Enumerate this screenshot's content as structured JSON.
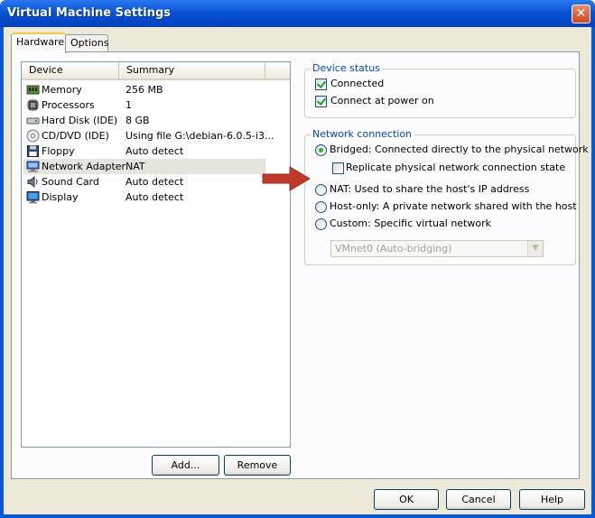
{
  "window": {
    "title": "Virtual Machine Settings",
    "close": "✕"
  },
  "tabs": [
    {
      "label": "Hardware"
    },
    {
      "label": "Options"
    }
  ],
  "device_list": {
    "columns": [
      "Device",
      "Summary"
    ],
    "rows": [
      {
        "device": "Memory",
        "summary": "256 MB",
        "icon": "memory-icon"
      },
      {
        "device": "Processors",
        "summary": "1",
        "icon": "processor-icon"
      },
      {
        "device": "Hard Disk (IDE)",
        "summary": "8 GB",
        "icon": "hard-disk-icon"
      },
      {
        "device": "CD/DVD (IDE)",
        "summary": "Using file G:\\debian-6.0.5-i3...",
        "icon": "cd-dvd-icon"
      },
      {
        "device": "Floppy",
        "summary": "Auto detect",
        "icon": "floppy-icon"
      },
      {
        "device": "Network Adapter",
        "summary": "NAT",
        "icon": "network-adapter-icon"
      },
      {
        "device": "Sound Card",
        "summary": "Auto detect",
        "icon": "sound-card-icon"
      },
      {
        "device": "Display",
        "summary": "Auto detect",
        "icon": "display-icon"
      }
    ]
  },
  "list_buttons": {
    "add": "Add...",
    "remove": "Remove"
  },
  "device_status": {
    "title": "Device status",
    "connected": "Connected",
    "connect_at_power_on": "Connect at power on"
  },
  "network_connection": {
    "title": "Network connection",
    "bridged": "Bridged: Connected directly to the physical network",
    "replicate": "Replicate physical network connection state",
    "nat": "NAT: Used to share the host's IP address",
    "host_only": "Host-only: A private network shared with the host",
    "custom": "Custom: Specific virtual network",
    "custom_select": "VMnet0 (Auto-bridging)"
  },
  "footer": {
    "ok": "OK",
    "cancel": "Cancel",
    "help": "Help"
  },
  "colors": {
    "title_bar": "#0753d6",
    "dialog": "#ece9d8",
    "arrow": "#c0392b",
    "group_label": "#0046d5"
  }
}
